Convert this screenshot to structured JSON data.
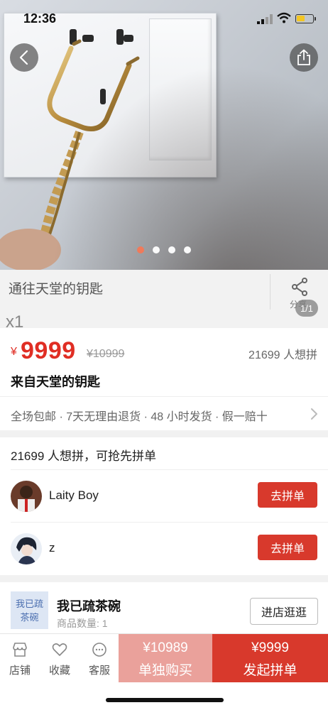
{
  "status_bar": {
    "time": "12:36"
  },
  "gallery": {
    "dots": [
      true,
      false,
      false,
      false
    ]
  },
  "title_strip": {
    "title": "通往天堂的钥匙",
    "quantity": "x1",
    "share_label": "分享",
    "image_counter": "1/1"
  },
  "price": {
    "currency": "¥",
    "current": "9999",
    "original": "¥10999",
    "wants": "21699 人想拼"
  },
  "goods_name": "来自天堂的钥匙",
  "services": "全场包邮 · 7天无理由退货 · 48 小时发货 · 假一赔十",
  "group": {
    "header": "21699 人想拼，可抢先拼单",
    "rows": [
      {
        "name": "Laity  Boy",
        "button": "去拼单"
      },
      {
        "name": "z",
        "button": "去拼单"
      }
    ]
  },
  "store": {
    "logo_line1": "我已疏",
    "logo_line2": "茶碗",
    "name": "我已疏茶碗",
    "count": "商品数量: 1",
    "button": "进店逛逛"
  },
  "bottom_bar": {
    "store_label": "店铺",
    "favorite_label": "收藏",
    "service_label": "客服",
    "buy_alone_price": "¥10989",
    "buy_alone_label": "单独购买",
    "buy_group_price": "¥9999",
    "buy_group_label": "发起拼单"
  },
  "colors": {
    "accent": "#d8392c",
    "price": "#e02e24",
    "buy_alone": "#eaa19b"
  }
}
